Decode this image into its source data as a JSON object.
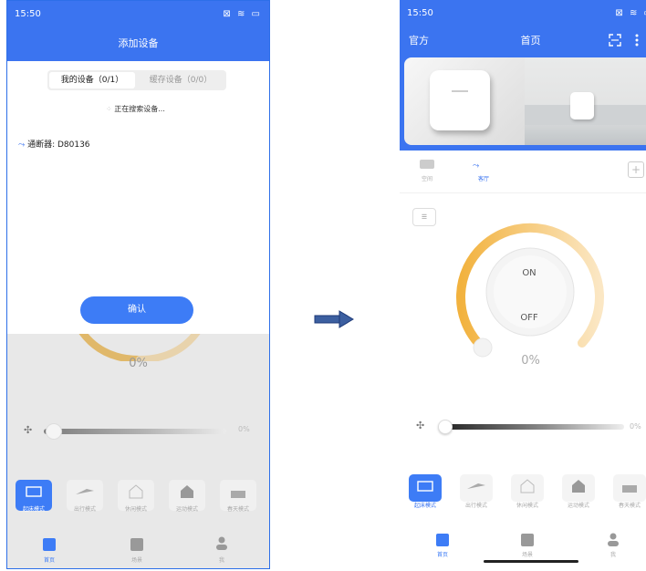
{
  "left": {
    "status": {
      "time": "15:50",
      "icons": "⊠ ≋ ▭"
    },
    "title": "添加设备",
    "tabs": [
      "我的设备（0/1）",
      "缓存设备（0/0）"
    ],
    "searching": "正在搜索设备...",
    "device": {
      "icon": "breaker-icon",
      "label": "通断器: D80136"
    },
    "confirm": "确认",
    "percent": "0%",
    "slider_percent": "0%",
    "modes": [
      "起床模式",
      "出行模式",
      "休闲模式",
      "运动模式",
      "春天模式"
    ],
    "nav": [
      "首页",
      "场景",
      "我"
    ]
  },
  "right": {
    "status": {
      "time": "15:50",
      "icons": "⊠ ≋ ▭"
    },
    "brand": "官方",
    "title": "首页",
    "rooms": [
      "空间",
      "客厅"
    ],
    "on": "ON",
    "off": "OFF",
    "percent": "0%",
    "slider_percent": "0%",
    "modes": [
      "起床模式",
      "出行模式",
      "休闲模式",
      "运动模式",
      "春天模式"
    ],
    "nav": [
      "首页",
      "场景",
      "我"
    ]
  },
  "colors": {
    "primary": "#3b74f0",
    "accent_orange": "#f3b84e"
  }
}
